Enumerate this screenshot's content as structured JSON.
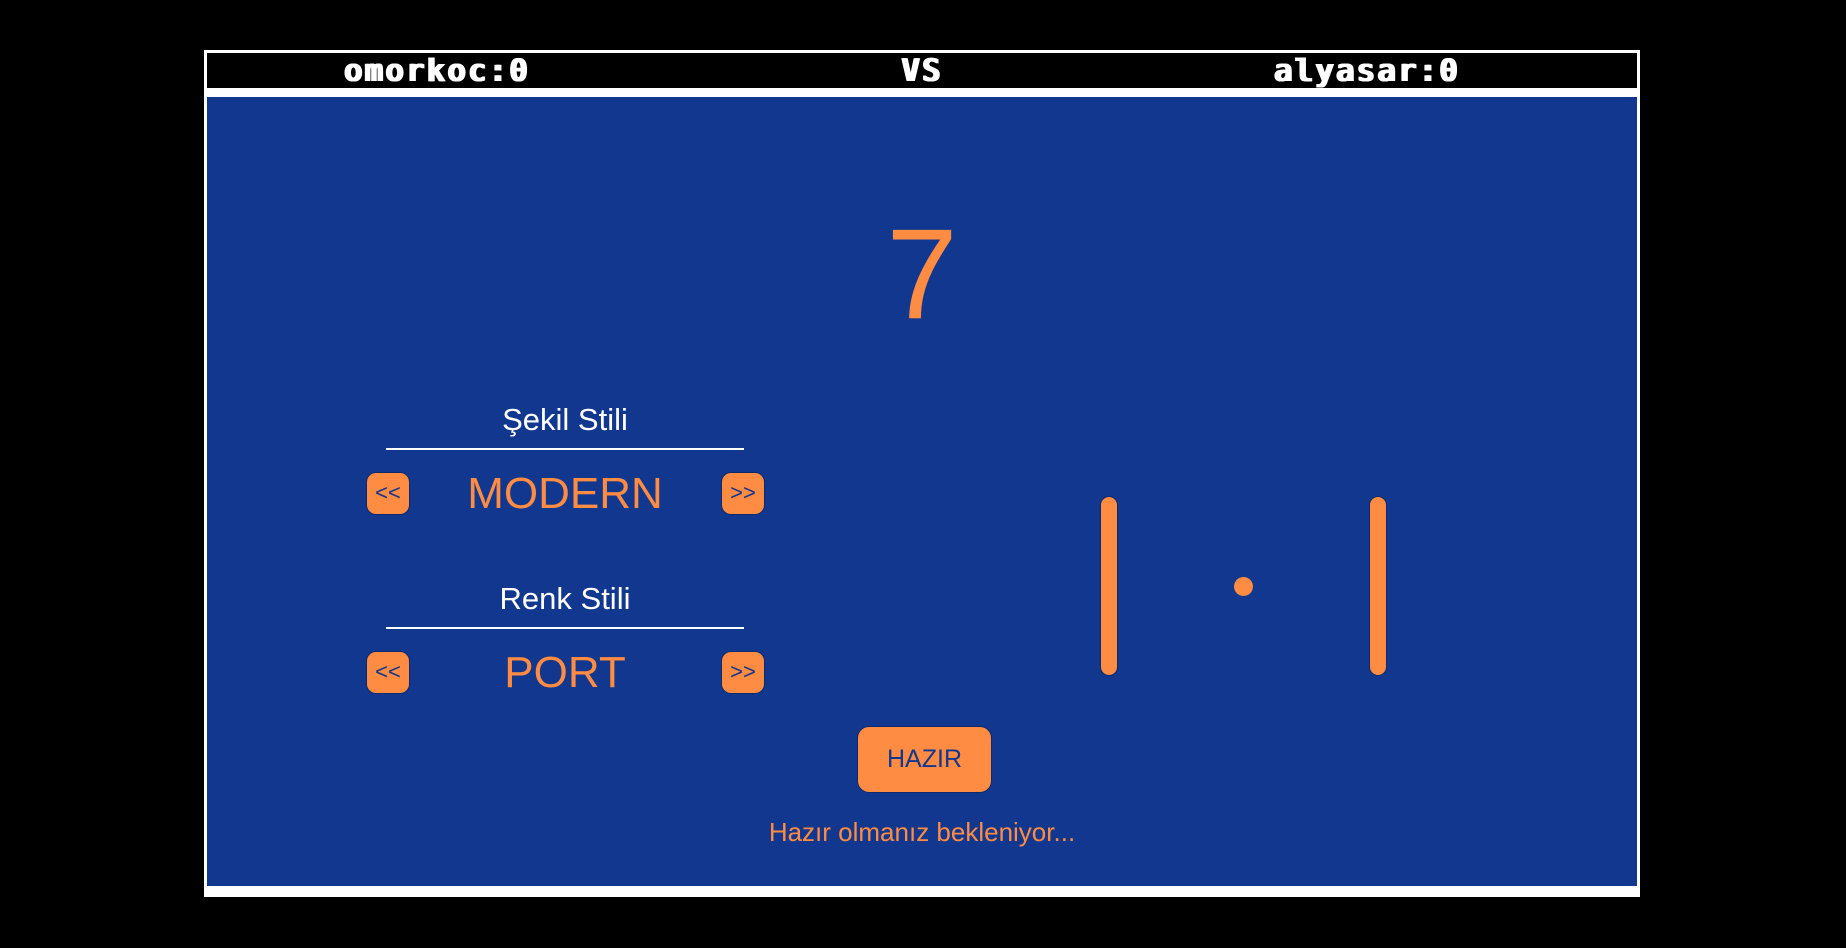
{
  "scoreboard": {
    "player1": "omorkoc:0",
    "vs": "VS",
    "player2": "alyasar:0"
  },
  "countdown": "7",
  "shape_style": {
    "title": "Şekil Stili",
    "prev": "<<",
    "value": "MODERN",
    "next": ">>"
  },
  "color_style": {
    "title": "Renk Stili",
    "prev": "<<",
    "value": "PORT",
    "next": ">>"
  },
  "ready_button": "HAZIR",
  "status": "Hazır olmanız bekleniyor...",
  "colors": {
    "background": "#000000",
    "field": "#12378e",
    "accent": "#ff8c42",
    "text": "#ffffff"
  }
}
